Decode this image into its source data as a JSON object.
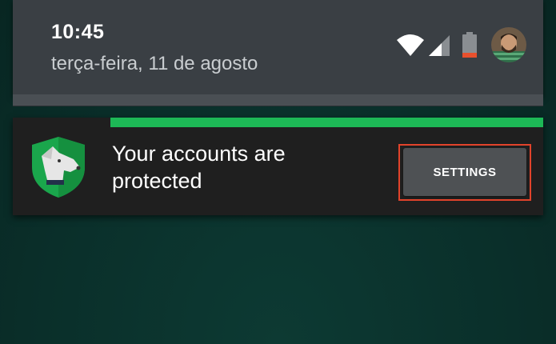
{
  "status_bar": {
    "time": "10:45",
    "date": "terça-feira, 11 de agosto",
    "icons": [
      "wifi-icon",
      "cellular-signal-icon",
      "battery-low-icon",
      "user-avatar"
    ]
  },
  "notification": {
    "app_icon": "lastpass-shield-dog-icon",
    "progress": 1.0,
    "message": "Your accounts are protected",
    "action_label": "SETTINGS"
  },
  "colors": {
    "shade_bg": "#3a3f44",
    "card_bg": "#1f1f1f",
    "progress_green": "#1db856",
    "button_bg": "#4e5154",
    "highlight_outline": "#e2432b",
    "battery_red": "#e8502d"
  }
}
